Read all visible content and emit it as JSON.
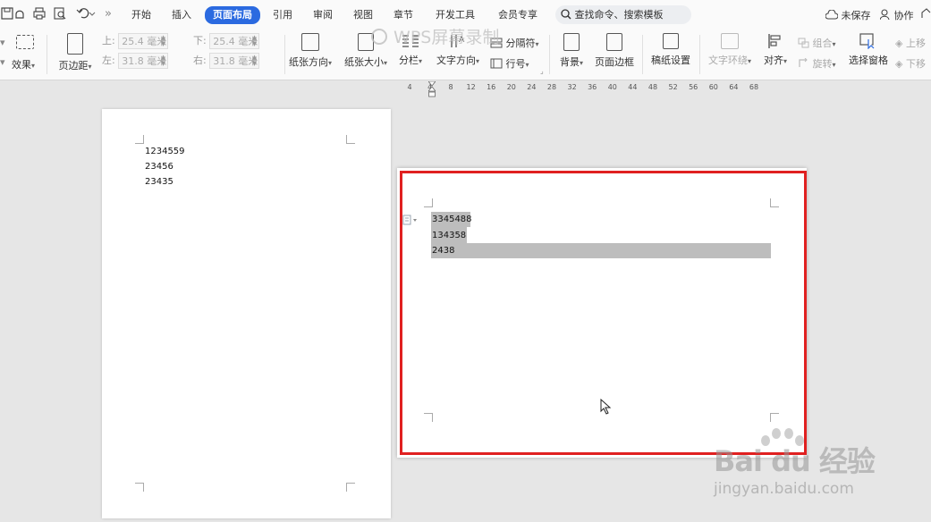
{
  "menubar": {
    "tabs": [
      {
        "label": "开始"
      },
      {
        "label": "插入"
      },
      {
        "label": "页面布局"
      },
      {
        "label": "引用"
      },
      {
        "label": "审阅"
      },
      {
        "label": "视图"
      },
      {
        "label": "章节"
      },
      {
        "label": "开发工具"
      },
      {
        "label": "会员专享"
      }
    ],
    "more_label": "»",
    "search_label": "查找命令、搜索模板",
    "unsaved_label": "未保存",
    "collab_label": "协作"
  },
  "ribbon": {
    "effects_label": "效果",
    "margins_label": "页边距",
    "margin_top_label": "上:",
    "margin_top_value": "25.4 毫米",
    "margin_bottom_label": "下:",
    "margin_bottom_value": "25.4 毫米",
    "margin_left_label": "左:",
    "margin_left_value": "31.8 毫米",
    "margin_right_label": "右:",
    "margin_right_value": "31.8 毫米",
    "orientation_label": "纸张方向",
    "size_label": "纸张大小",
    "columns_label": "分栏",
    "text_direction_label": "文字方向",
    "breaks_label": "分隔符",
    "line_numbers_label": "行号",
    "background_label": "背景",
    "page_border_label": "页面边框",
    "manuscript_label": "稿纸设置",
    "wrap_text_label": "文字环绕",
    "align_label": "对齐",
    "group_label": "组合",
    "rotate_label": "旋转",
    "selection_pane_label": "选择窗格",
    "bring_forward_label": "上移",
    "send_backward_label": "下移"
  },
  "overlay": {
    "recorder_watermark": "WPS屏幕录制"
  },
  "ruler": {
    "ticks": [
      "4",
      "4",
      "8",
      "12",
      "16",
      "20",
      "24",
      "28",
      "32",
      "36",
      "40",
      "44",
      "48",
      "52",
      "56",
      "60",
      "64",
      "68"
    ]
  },
  "document": {
    "page1_lines": [
      "1234559",
      "23456",
      "23435"
    ],
    "page2_lines": [
      "3345488",
      "134358",
      "2438"
    ]
  },
  "watermark": {
    "brand": "Bai du 经验",
    "url": "jingyan.baidu.com"
  },
  "colors": {
    "accent": "#2b6ae0",
    "highlight_frame": "#e02020",
    "selection": "#bdbdbd"
  }
}
